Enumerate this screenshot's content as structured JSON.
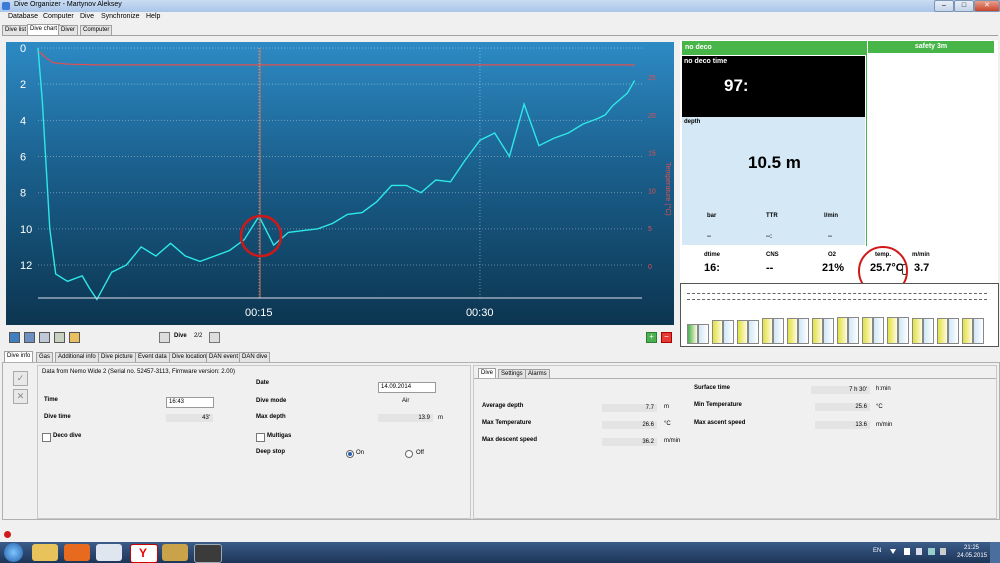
{
  "window": {
    "title": "Dive Organizer - Martynov Aleksey"
  },
  "menu": [
    "Database",
    "Computer",
    "Dive",
    "Synchronize",
    "Help"
  ],
  "top_tabs": [
    "Dive list",
    "Dive chart",
    "Diver",
    "Computer"
  ],
  "chart": {
    "y_ticks": [
      "0",
      "2",
      "4",
      "6",
      "8",
      "10",
      "12"
    ],
    "x_ticks": [
      "00:15",
      "00:30"
    ],
    "right_ticks": [
      "25",
      "20",
      "15",
      "10",
      "5",
      "0"
    ],
    "right_axis_label": "Temperature (°C)"
  },
  "chart_data": {
    "type": "line",
    "title": "",
    "xlabel": "",
    "ylabel": "",
    "x_range_min": [
      0,
      41
    ],
    "y_range_depth_m": [
      0,
      13.9
    ],
    "series": [
      {
        "name": "",
        "color": "#2ee8e8",
        "x_min": [
          0,
          0.3,
          0.8,
          1.2,
          2,
          3,
          3.5,
          4,
          5,
          6,
          7,
          8,
          9,
          10,
          11,
          12,
          13,
          14,
          15,
          16,
          17,
          18,
          19,
          20,
          21,
          22,
          23,
          24,
          25,
          26,
          27,
          28,
          29,
          30,
          31,
          32,
          33,
          34,
          35,
          36,
          37,
          38,
          38.5,
          39,
          40,
          40.5
        ],
        "depth_m": [
          0,
          3,
          10,
          12.5,
          12.9,
          12.6,
          13.3,
          13.9,
          12.4,
          12,
          11,
          11.5,
          10.8,
          11.5,
          11.8,
          11.5,
          11.2,
          10.6,
          9.3,
          10.9,
          10.2,
          10.1,
          10.0,
          9.7,
          9.2,
          9.1,
          8.5,
          7.6,
          7.6,
          8.0,
          7.3,
          7.4,
          6.2,
          5.1,
          4.7,
          6.0,
          3.1,
          5.4,
          5.0,
          4.7,
          4.2,
          3.9,
          3.7,
          3.2,
          2.5,
          1.8
        ]
      },
      {
        "name": "",
        "color": "#e05050",
        "unit": "°C",
        "x_min": [
          0,
          0.5,
          1,
          2,
          4,
          8,
          15,
          25,
          35,
          40.5
        ],
        "values": [
          28.5,
          27.6,
          26.9,
          26.7,
          26.6,
          26.6,
          26.6,
          26.6,
          26.6,
          26.6
        ]
      }
    ]
  },
  "chart_controls": {
    "dive_label": "Dive",
    "dive_pos": "2/2"
  },
  "right_panel": {
    "no_deco": "no deco",
    "safety": "safety 3m",
    "no_deco_time_label": "no deco time",
    "no_deco_time": "97:",
    "depth_label": "depth",
    "depth_value": "10.5 m",
    "bar_label": "bar",
    "bar_val": "--",
    "ttr_label": "TTR",
    "ttr_val": "--:",
    "lmin_label": "l/min",
    "lmin_val": "--",
    "dtime_label": "dtime",
    "dtime_val": "16:",
    "cns_label": "CNS",
    "cns_val": "--",
    "o2_label": "O2",
    "o2_val": "21%",
    "temp_label": "temp.",
    "temp_val": "25.7°C",
    "mmin_label": "m/min",
    "mmin_val": "3.7"
  },
  "lower_tabs": [
    "Dive info",
    "Gas",
    "Additional info",
    "Dive picture",
    "Event data",
    "Dive location",
    "DAN event",
    "DAN dive"
  ],
  "dive_info": {
    "source": "Data from Nemo Wide 2 (Serial no. 52457-3113, Firmware version: 2.00)",
    "time_label": "Time",
    "time_val": "16:43",
    "divetime_label": "Dive time",
    "divetime_val": "43'",
    "deco_label": "Deco dive",
    "date_label": "Date",
    "date_val": "14.09.2014",
    "divemode_label": "Dive mode",
    "divemode_val": "Air",
    "maxdepth_label": "Max depth",
    "maxdepth_val": "13.9",
    "maxdepth_unit": "m",
    "multigas_label": "Multigas",
    "deepstop_label": "Deep stop",
    "on_label": "On",
    "off_label": "Off"
  },
  "stats_tabs": [
    "Dive",
    "Settings",
    "Alarms"
  ],
  "stats": {
    "surface_label": "Surface time",
    "surface_val": "7 h 30'",
    "surface_unit": "h:min",
    "avgdepth_label": "Average depth",
    "avgdepth_val": "7.7",
    "avgdepth_unit": "m",
    "mintemp_label": "Min Temperature",
    "mintemp_val": "25.6",
    "mintemp_unit": "°C",
    "maxtemp_label": "Max Temperature",
    "maxtemp_val": "26.6",
    "maxtemp_unit": "°C",
    "maxasc_label": "Max ascent speed",
    "maxasc_val": "13.6",
    "maxasc_unit": "m/min",
    "maxdesc_label": "Max descent speed",
    "maxdesc_val": "36.2",
    "maxdesc_unit": "m/min"
  },
  "taskbar": {
    "lang": "EN",
    "time": "21:25",
    "date": "24.05.2015"
  }
}
